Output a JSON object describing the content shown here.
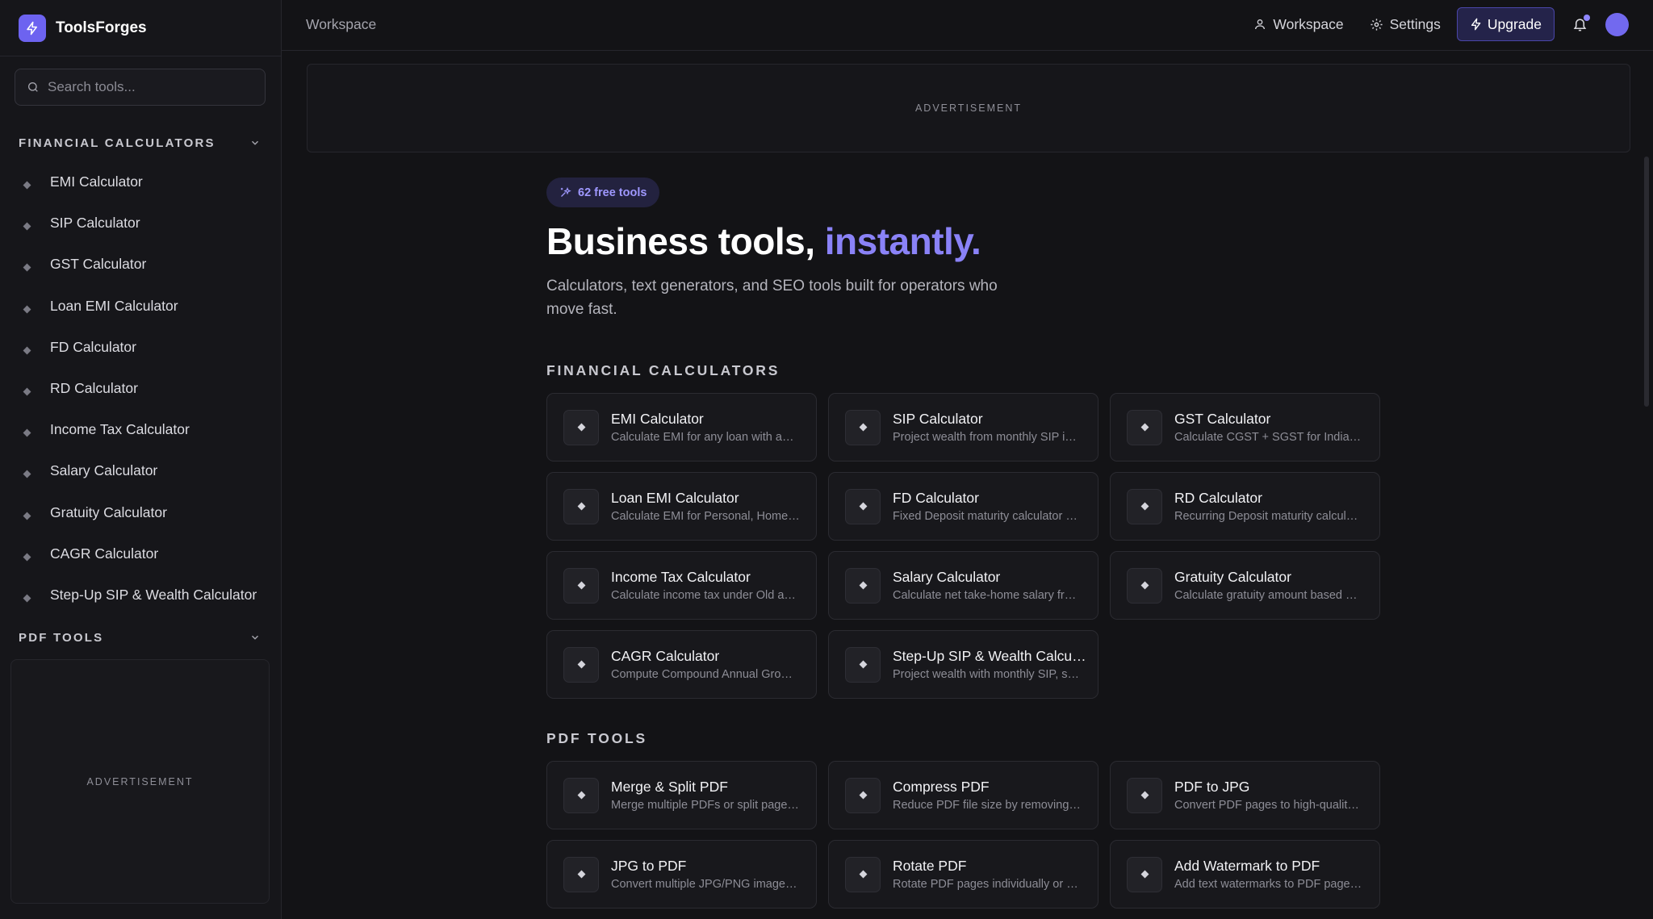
{
  "brand": {
    "name": "ToolsForges"
  },
  "sidebar": {
    "search_placeholder": "Search tools...",
    "financial_heading": "FINANCIAL CALCULATORS",
    "items": [
      {
        "label": "EMI Calculator"
      },
      {
        "label": "SIP Calculator"
      },
      {
        "label": "GST Calculator"
      },
      {
        "label": "Loan EMI Calculator"
      },
      {
        "label": "FD Calculator"
      },
      {
        "label": "RD Calculator"
      },
      {
        "label": "Income Tax Calculator"
      },
      {
        "label": "Salary Calculator"
      },
      {
        "label": "Gratuity Calculator"
      },
      {
        "label": "CAGR Calculator"
      },
      {
        "label": "Step-Up SIP & Wealth Calculator"
      }
    ],
    "pdf_heading": "PDF TOOLS",
    "ad_label": "ADVERTISEMENT"
  },
  "header": {
    "breadcrumb": "Workspace",
    "workspace_label": "Workspace",
    "settings_label": "Settings",
    "upgrade_label": "Upgrade"
  },
  "top_ad": {
    "label": "ADVERTISEMENT"
  },
  "hero": {
    "pill": "62 free tools",
    "title_main": "Business tools, ",
    "title_accent": "instantly.",
    "subtitle": "Calculators, text generators, and SEO tools built for operators who move fast."
  },
  "financial": {
    "title": "FINANCIAL CALCULATORS",
    "cards": [
      {
        "name": "EMI Calculator",
        "desc": "Calculate EMI for any loan with a…"
      },
      {
        "name": "SIP Calculator",
        "desc": "Project wealth from monthly SIP i…"
      },
      {
        "name": "GST Calculator",
        "desc": "Calculate CGST + SGST for India…"
      },
      {
        "name": "Loan EMI Calculator",
        "desc": "Calculate EMI for Personal, Home…"
      },
      {
        "name": "FD Calculator",
        "desc": "Fixed Deposit maturity calculator …"
      },
      {
        "name": "RD Calculator",
        "desc": "Recurring Deposit maturity calcul…"
      },
      {
        "name": "Income Tax Calculator",
        "desc": "Calculate income tax under Old a…"
      },
      {
        "name": "Salary Calculator",
        "desc": "Calculate net take-home salary fr…"
      },
      {
        "name": "Gratuity Calculator",
        "desc": "Calculate gratuity amount based …"
      },
      {
        "name": "CAGR Calculator",
        "desc": "Compute Compound Annual Gro…"
      },
      {
        "name": "Step-Up SIP & Wealth Calcu…",
        "desc": "Project wealth with monthly SIP, s…"
      }
    ]
  },
  "pdf": {
    "title": "PDF TOOLS",
    "cards": [
      {
        "name": "Merge & Split PDF",
        "desc": "Merge multiple PDFs or split page…"
      },
      {
        "name": "Compress PDF",
        "desc": "Reduce PDF file size by removing…"
      },
      {
        "name": "PDF to JPG",
        "desc": "Convert PDF pages to high-qualit…"
      },
      {
        "name": "JPG to PDF",
        "desc": "Convert multiple JPG/PNG image…"
      },
      {
        "name": "Rotate PDF",
        "desc": "Rotate PDF pages individually or …"
      },
      {
        "name": "Add Watermark to PDF",
        "desc": "Add text watermarks to PDF page…"
      }
    ]
  },
  "colors": {
    "accent": "#6d63f0",
    "accent_text": "#8a82f7",
    "background": "#131316"
  },
  "icons": {
    "brand": "lightning-icon",
    "search": "search-icon",
    "workspace": "user-icon",
    "settings": "gear-icon",
    "upgrade": "lightning-icon",
    "notifications": "bell-icon",
    "pill": "sparkles-icon",
    "tile": "diamond-icon",
    "collapse": "chevron-down-icon"
  }
}
